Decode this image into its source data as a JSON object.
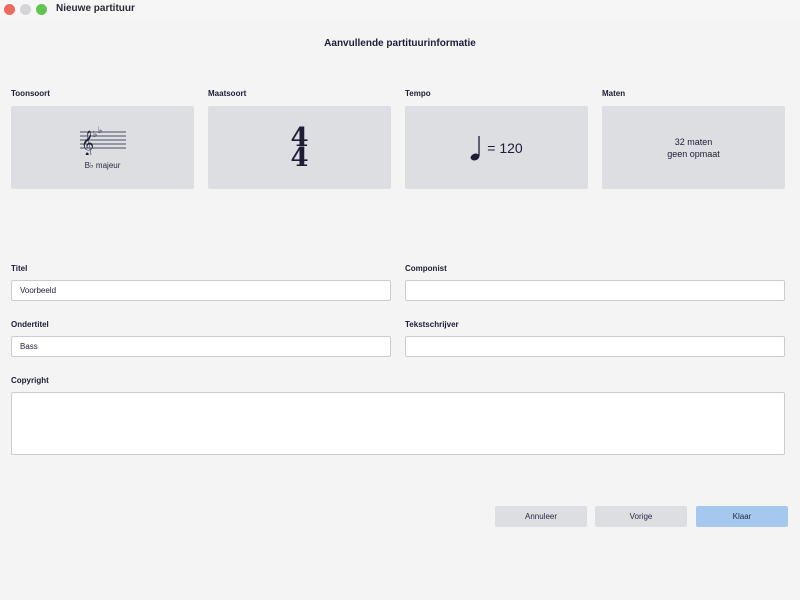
{
  "window": {
    "title": "Nieuwe partituur"
  },
  "heading": "Aanvullende partituurinformatie",
  "cards": {
    "key": {
      "label": "Toonsoort",
      "value": "B♭ majeur",
      "icon": "treble-clef-key-signature-icon"
    },
    "time": {
      "label": "Maatsoort",
      "numerator": "4",
      "denominator": "4"
    },
    "tempo": {
      "label": "Tempo",
      "value": "= 120",
      "icon": "quarter-note-icon"
    },
    "measures": {
      "label": "Maten",
      "count": "32 maten",
      "pickup": "geen opmaat"
    }
  },
  "fields": {
    "title": {
      "label": "Titel",
      "value": "Voorbeeld"
    },
    "composer": {
      "label": "Componist",
      "value": ""
    },
    "subtitle": {
      "label": "Ondertitel",
      "value": "Bass"
    },
    "lyricist": {
      "label": "Tekstschrijver",
      "value": ""
    },
    "copyright": {
      "label": "Copyright",
      "value": ""
    }
  },
  "buttons": {
    "cancel": "Annuleer",
    "back": "Vorige",
    "finish": "Klaar"
  },
  "colors": {
    "background": "#f4f4f5",
    "card": "#dcdee2",
    "primary_button": "#a5c8ee",
    "text": "#1d1d35"
  }
}
